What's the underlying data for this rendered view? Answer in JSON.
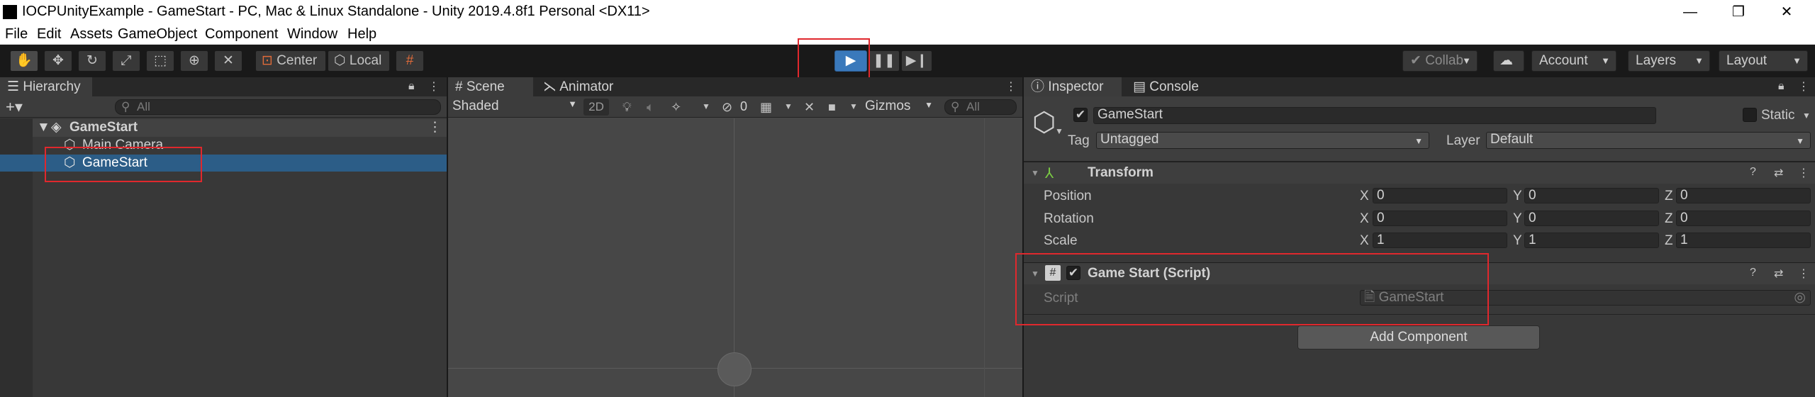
{
  "window": {
    "title": "IOCPUnityExample - GameStart - PC, Mac & Linux Standalone - Unity 2019.4.8f1 Personal <DX11>",
    "minimize": "—",
    "maximize": "❐",
    "close": "✕"
  },
  "menu": [
    "File",
    "Edit",
    "Assets",
    "GameObject",
    "Component",
    "Window",
    "Help"
  ],
  "toolbar": {
    "pivot_label": "Center",
    "space_label": "Local",
    "collab_label": "Collab",
    "account_label": "Account",
    "layers_label": "Layers",
    "layout_label": "Layout"
  },
  "hierarchy": {
    "tab_label": "Hierarchy",
    "search_placeholder": "All",
    "scene_name": "GameStart",
    "items": [
      "Main Camera",
      "GameStart"
    ]
  },
  "scene": {
    "tabs": [
      "Scene",
      "Animator"
    ],
    "shading_mode": "Shaded",
    "mode_2d": "2D",
    "hidden_count": "0",
    "gizmos_label": "Gizmos",
    "search_placeholder": "All"
  },
  "inspector": {
    "tabs": [
      "Inspector",
      "Console"
    ],
    "object_name": "GameStart",
    "static_label": "Static",
    "tag_label": "Tag",
    "tag_value": "Untagged",
    "layer_label": "Layer",
    "layer_value": "Default",
    "transform": {
      "title": "Transform",
      "rows": [
        {
          "label": "Position",
          "x": "0",
          "y": "0",
          "z": "0"
        },
        {
          "label": "Rotation",
          "x": "0",
          "y": "0",
          "z": "0"
        },
        {
          "label": "Scale",
          "x": "1",
          "y": "1",
          "z": "1"
        }
      ],
      "axis_x": "X",
      "axis_y": "Y",
      "axis_z": "Z"
    },
    "script_component": {
      "title": "Game Start (Script)",
      "script_label": "Script",
      "script_value": "GameStart"
    },
    "add_component_label": "Add Component"
  },
  "colors": {
    "accent_play": "#3a79bb",
    "selection": "#2c5d87",
    "highlight_box": "#e0282d"
  }
}
